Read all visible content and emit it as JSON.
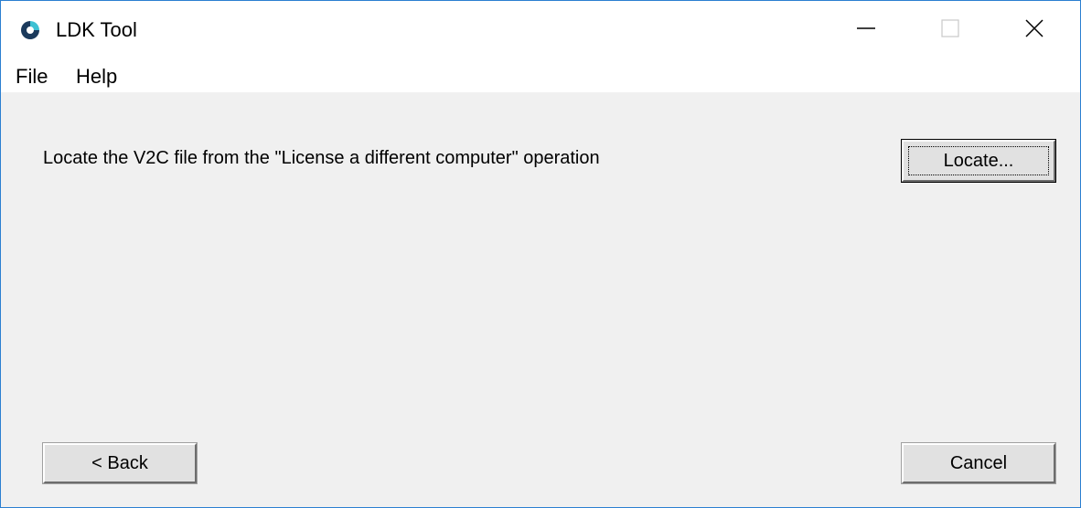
{
  "window": {
    "title": "LDK Tool",
    "icon": "app-icon",
    "controls": [
      "minimize-icon",
      "maximize-icon",
      "close-icon"
    ],
    "accent_color": "#2b7fd1"
  },
  "menu": {
    "items": [
      {
        "label": "File"
      },
      {
        "label": "Help"
      }
    ]
  },
  "main": {
    "prompt": "Locate the V2C file from the \"License a different computer\" operation",
    "locate_label": "Locate...",
    "back_label": "< Back",
    "cancel_label": "Cancel"
  }
}
